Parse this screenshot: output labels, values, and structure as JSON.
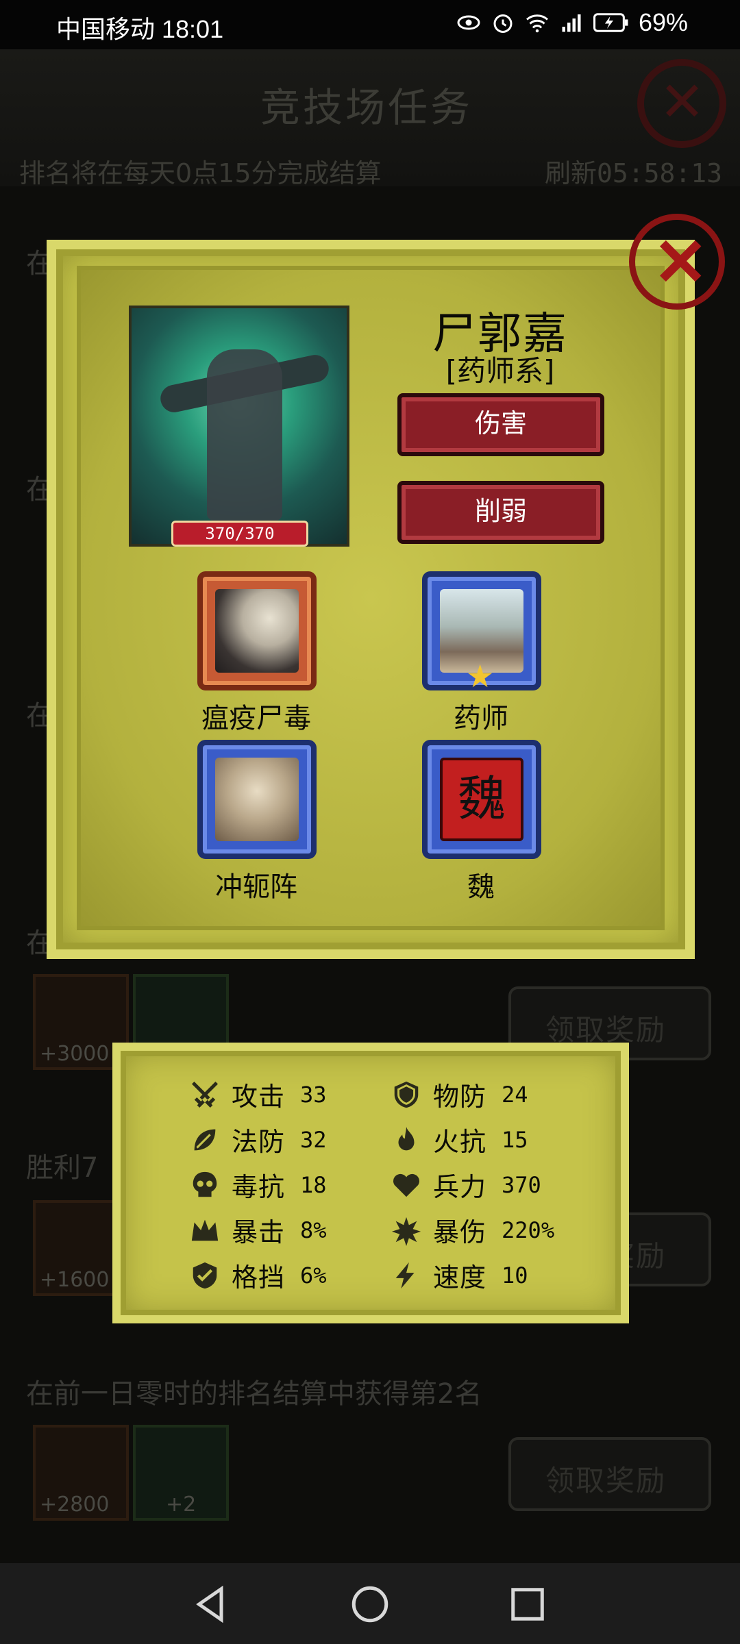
{
  "status_bar": {
    "carrier_time": "中国移动 18:01",
    "battery": "69%"
  },
  "background": {
    "title": "竞技场任务",
    "subtitle": "排名将在每天0点15分完成结算",
    "refresh": "刷新05:58:13",
    "rows": [
      {
        "label": "在",
        "reward_amount": ""
      },
      {
        "label": "在",
        "reward_amount": ""
      },
      {
        "label": "在",
        "reward_amount": ""
      },
      {
        "label": "在",
        "reward_amount": "+3000"
      },
      {
        "label": "胜利7",
        "reward_amount": "+1600"
      },
      {
        "label": "在前一日零时的排名结算中获得第2名",
        "reward_amount": "+2800",
        "second_amount": "+2"
      }
    ],
    "claim_label": "领取奖励"
  },
  "hero": {
    "name": "尸郭嘉",
    "class": "[药师系]",
    "hp": "370/370",
    "tags": [
      "伤害",
      "削弱"
    ],
    "skills": [
      {
        "name": "瘟疫尸毒",
        "frame": "orange"
      },
      {
        "name": "药师",
        "frame": "blue"
      },
      {
        "name": "冲轭阵",
        "frame": "blue"
      },
      {
        "name": "魏",
        "frame": "blue",
        "glyph": "魏"
      }
    ]
  },
  "stats": {
    "left": [
      {
        "icon": "crossed-swords-icon",
        "label": "攻击",
        "value": "33"
      },
      {
        "icon": "leaf-icon",
        "label": "法防",
        "value": "32"
      },
      {
        "icon": "skull-icon",
        "label": "毒抗",
        "value": "18"
      },
      {
        "icon": "crown-icon",
        "label": "暴击",
        "value": "8%"
      },
      {
        "icon": "shield-check-icon",
        "label": "格挡",
        "value": "6%"
      }
    ],
    "right": [
      {
        "icon": "shield-icon",
        "label": "物防",
        "value": "24"
      },
      {
        "icon": "flame-icon",
        "label": "火抗",
        "value": "15"
      },
      {
        "icon": "heart-icon",
        "label": "兵力",
        "value": "370"
      },
      {
        "icon": "burst-icon",
        "label": "暴伤",
        "value": "220%"
      },
      {
        "icon": "lightning-icon",
        "label": "速度",
        "value": "10"
      }
    ]
  }
}
